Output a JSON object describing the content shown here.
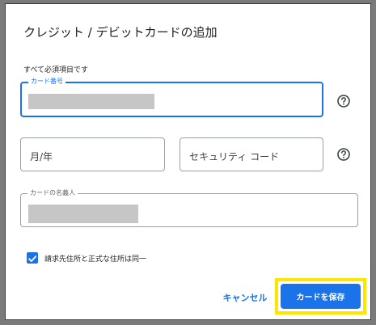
{
  "dialog": {
    "title": "クレジット / デビットカードの追加",
    "required_note": "すべて必須項目です"
  },
  "card_number": {
    "label": "カード番号"
  },
  "expiry": {
    "placeholder": "月/年"
  },
  "security_code": {
    "placeholder": "セキュリティ コード"
  },
  "card_name": {
    "label": "カードの名義人"
  },
  "billing": {
    "checked": true,
    "label": "請求先住所と正式な住所は同一"
  },
  "actions": {
    "cancel_label": "キャンセル",
    "save_label": "カードを保存"
  },
  "colors": {
    "accent": "#1a73e8",
    "highlight": "#ffe600"
  },
  "icons": {
    "help": "help-circle-icon",
    "check": "checkmark-icon"
  }
}
